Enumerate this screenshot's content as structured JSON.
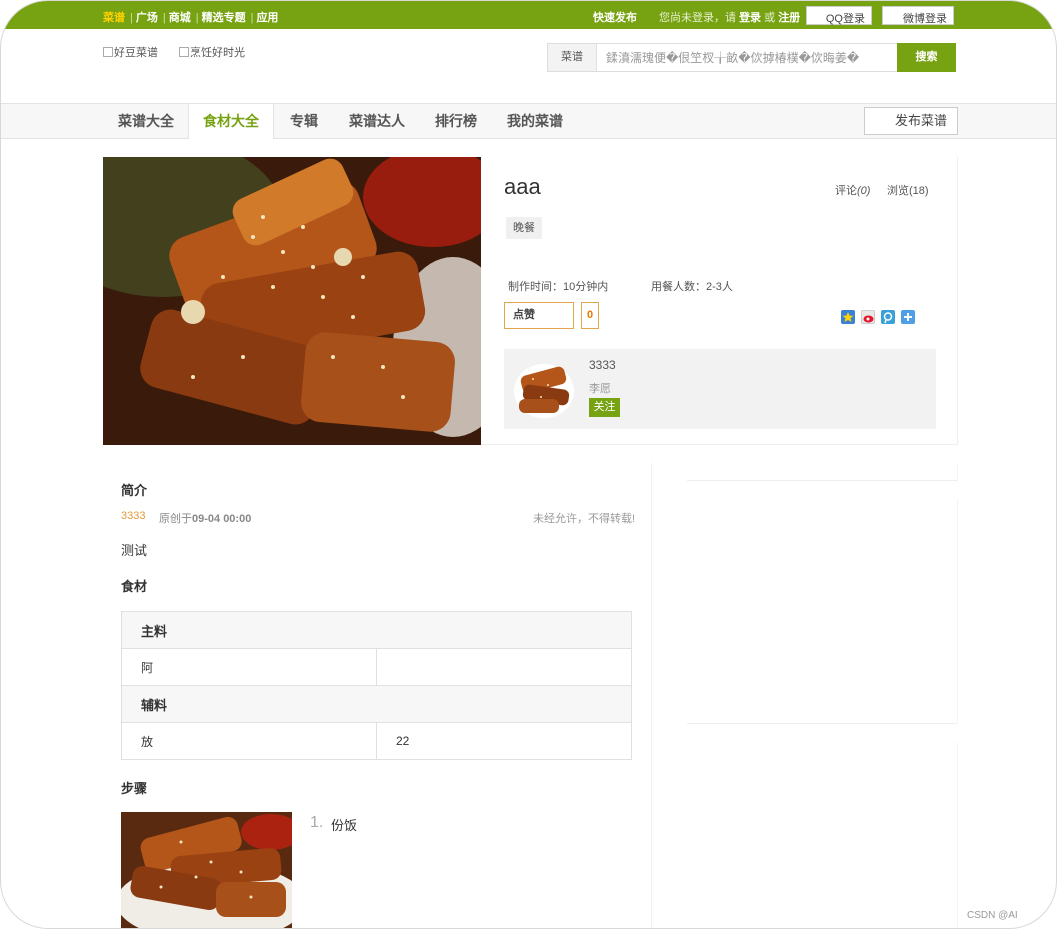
{
  "topbar": {
    "links": [
      "菜谱",
      "广场",
      "商城",
      "精选专题",
      "应用"
    ],
    "quick_publish": "快速发布",
    "login_prefix": "您尚未登录，请",
    "login": "登录",
    "or": "或",
    "register": "注册",
    "qq_login": "QQ登录",
    "weibo_login": "微博登录"
  },
  "header": {
    "logo_alt": "好豆菜谱",
    "slogan_alt": "烹饪好时光",
    "search_category": "菜谱",
    "search_value": "鍒濆濡瑰便�佷笁杈╁畝�佽摢椿樸�佽晦姜�",
    "search_button": "搜索"
  },
  "nav": {
    "items": [
      "菜谱大全",
      "食材大全",
      "专辑",
      "菜谱达人",
      "排行榜",
      "我的菜谱"
    ],
    "active_index": 1,
    "publish_button": "发布菜谱"
  },
  "recipe": {
    "title": "aaa",
    "comments_label": "评论",
    "comments_count": "(0)",
    "views_label": "浏览",
    "views_count": "(18)",
    "tag": "晚餐",
    "cook_time": "制作时间：10分钟内",
    "servings": "用餐人数：2-3人",
    "like_label": "点赞",
    "like_count": "0"
  },
  "author": {
    "name": "3333",
    "subtitle": "李愿",
    "follow": "关注"
  },
  "intro": {
    "heading": "简介",
    "author": "3333",
    "created_prefix": "原创于",
    "created_date": "09-04 00:00",
    "notice": "未经允许，不得转载!",
    "description": "测试"
  },
  "ingredients": {
    "heading": "食材",
    "main_label": "主料",
    "main": [
      {
        "name": "阿",
        "amount": ""
      }
    ],
    "aux_label": "辅料",
    "aux": [
      {
        "name": "放",
        "amount": "22"
      }
    ]
  },
  "steps": {
    "heading": "步骤",
    "items": [
      {
        "num": "1.",
        "text": "份饭"
      }
    ]
  },
  "colors": {
    "brand": "#77a212",
    "accent": "#ffd200",
    "like_border": "#e1a64b"
  },
  "icons": [
    "qzone-icon",
    "weibo-icon",
    "tencent-icon",
    "more-share-icon"
  ],
  "watermark": "CSDN @AI"
}
